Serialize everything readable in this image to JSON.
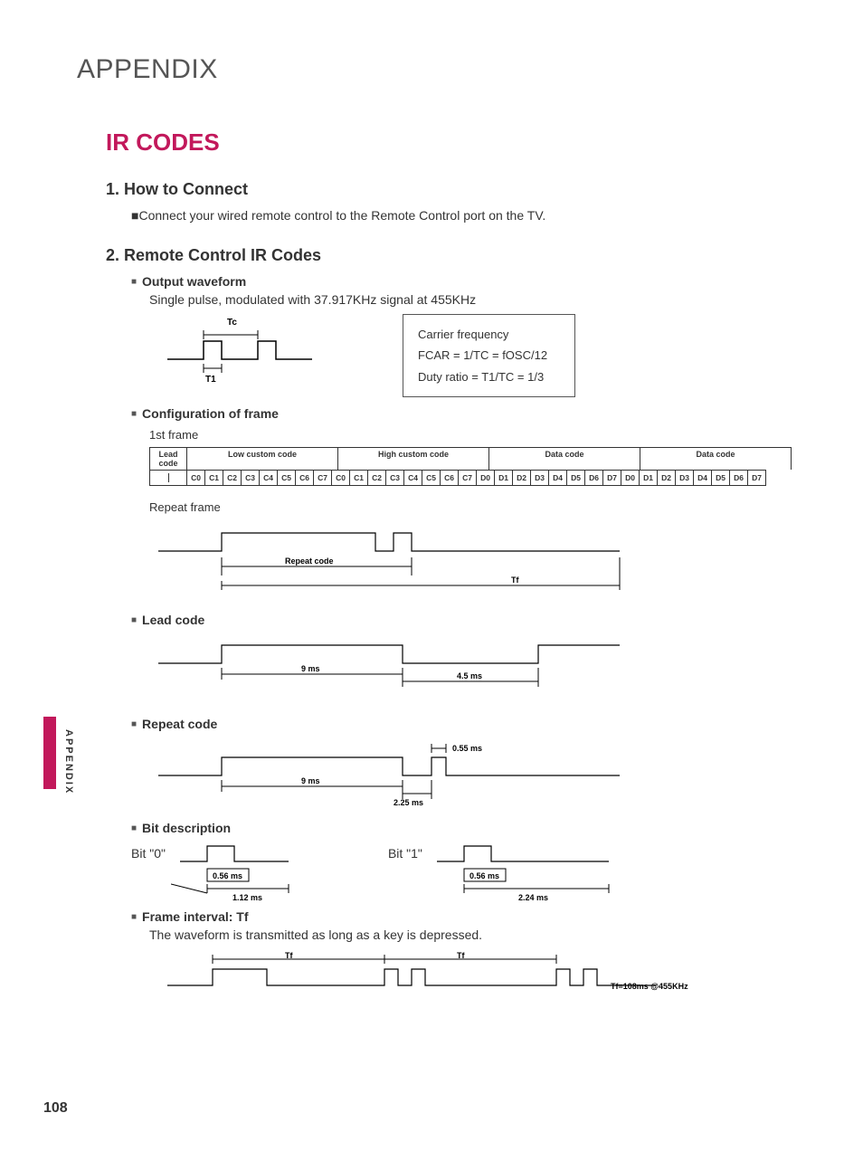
{
  "header": {
    "appendix": "APPENDIX"
  },
  "title": "IR CODES",
  "s1": {
    "heading": "1. How to Connect",
    "text": "Connect your wired remote control to the Remote Control port on the TV."
  },
  "s2": {
    "heading": "2. Remote Control IR Codes",
    "output": {
      "label": "Output waveform",
      "desc": "Single pulse, modulated with 37.917KHz signal at 455KHz",
      "tc": "Tc",
      "t1": "T1",
      "box_title": "Carrier frequency",
      "box_l1": "FCAR = 1/TC = fOSC/12",
      "box_l2": "Duty ratio = T1/TC = 1/3"
    },
    "config": {
      "label": "Configuration of frame",
      "first": "1st frame",
      "headers": [
        "Lead code",
        "Low custom code",
        "High custom code",
        "Data code",
        "Data code"
      ],
      "cells_low": [
        "C0",
        "C1",
        "C2",
        "C3",
        "C4",
        "C5",
        "C6",
        "C7"
      ],
      "cells_high": [
        "C0",
        "C1",
        "C2",
        "C3",
        "C4",
        "C5",
        "C6",
        "C7"
      ],
      "cells_d1": [
        "D0",
        "D1",
        "D2",
        "D3",
        "D4",
        "D5",
        "D6",
        "D7"
      ],
      "cells_d2": [
        "D0",
        "D1",
        "D2",
        "D3",
        "D4",
        "D5",
        "D6",
        "D7"
      ],
      "repeat": "Repeat frame",
      "repeat_code": "Repeat  code",
      "tf": "Tf"
    },
    "lead": {
      "label": "Lead code",
      "t1": "9 ms",
      "t2": "4.5 ms"
    },
    "repeatc": {
      "label": "Repeat code",
      "t1": "9 ms",
      "t2": "2.25 ms",
      "t3": "0.55 ms"
    },
    "bit": {
      "label": "Bit description",
      "b0": "Bit \"0\"",
      "b1": "Bit \"1\"",
      "p": "0.56 ms",
      "w0": "1.12 ms",
      "w1": "2.24 ms"
    },
    "frame_int": {
      "label": "Frame interval: Tf",
      "desc": "The waveform is transmitted as long as a key is depressed.",
      "tf": "Tf",
      "note": "Tf=108ms @455KHz"
    }
  },
  "side": "APPENDIX",
  "page": "108"
}
